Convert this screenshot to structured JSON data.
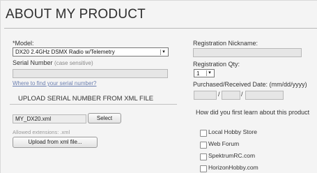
{
  "header": {
    "title": "ABOUT MY PRODUCT"
  },
  "left": {
    "model_label": "*Model:",
    "model_value": "DX20 2.4GHz DSMX Radio w/Telemetry",
    "serial_label": "Serial Number",
    "serial_note": "(case sensitive)",
    "serial_value": "",
    "find_serial_link": "Where to find your serial number?",
    "upload": {
      "title": "UPLOAD SERIAL NUMBER FROM XML FILE",
      "file_value": "MY_DX20.xml",
      "select_label": "Select",
      "allowed_ext": "Allowed extensions: .xml",
      "upload_button": "Upload from xml file..."
    }
  },
  "right": {
    "nickname_label": "Registration Nickname:",
    "nickname_value": "",
    "qty_label": "Registration Qty:",
    "qty_value": "1",
    "date_label": "Purchased/Received Date: (mm/dd/yyyy)",
    "date_sep": "/",
    "date_mm": "",
    "date_dd": "",
    "date_yyyy": "",
    "learn_label": "How did you first learn about this product",
    "options": [
      {
        "label": "Local Hobby Store",
        "checked": false
      },
      {
        "label": "Web Forum",
        "checked": false
      },
      {
        "label": "SpektrumRC.com",
        "checked": false
      },
      {
        "label": "HorizonHobby.com",
        "checked": false
      }
    ]
  },
  "icons": {
    "dropdown": "chevron-down-icon",
    "checkbox": "checkbox-icon"
  }
}
